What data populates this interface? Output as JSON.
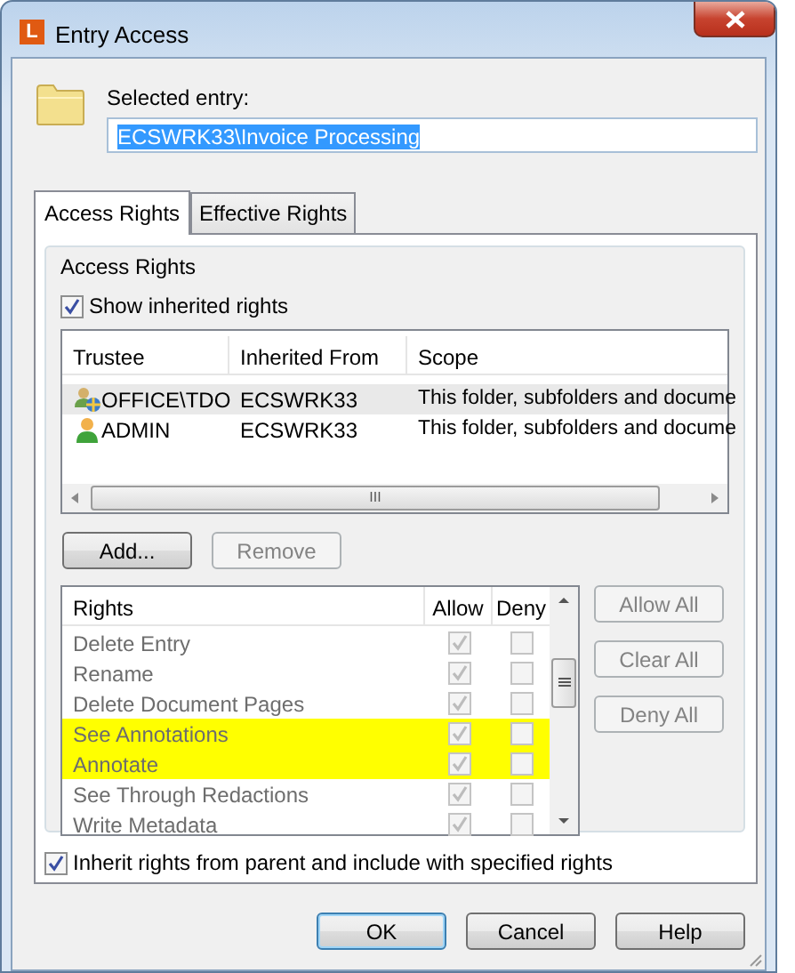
{
  "window": {
    "title": "Entry Access",
    "app_icon": "L"
  },
  "selected_entry": {
    "label": "Selected entry:",
    "value": "ECSWRK33\\Invoice Processing",
    "text_selected": true
  },
  "tabs": [
    {
      "label": "Access Rights",
      "selected": true
    },
    {
      "label": "Effective Rights",
      "selected": false
    }
  ],
  "group": {
    "title": "Access Rights",
    "show_inherited": {
      "label": "Show inherited rights",
      "checked": true
    },
    "trustees": {
      "columns": [
        "Trustee",
        "Inherited From",
        "Scope"
      ],
      "rows": [
        {
          "kind": "group",
          "trustee": "OFFICE\\TDO",
          "inherited_from": "ECSWRK33",
          "scope": "This folder, subfolders and docume",
          "selected": true
        },
        {
          "kind": "user",
          "trustee": "ADMIN",
          "inherited_from": "ECSWRK33",
          "scope": "This folder, subfolders and docume",
          "selected": false
        }
      ],
      "scroll_grip": "III"
    },
    "trustee_buttons": [
      {
        "label": "Add...",
        "disabled": false
      },
      {
        "label": "Remove",
        "disabled": true
      }
    ],
    "rights": {
      "columns": [
        "Rights",
        "Allow",
        "Deny"
      ],
      "rows": [
        {
          "name": "Delete Entry",
          "allow": true,
          "deny": false,
          "disabled": true,
          "highlighted": false
        },
        {
          "name": "Rename",
          "allow": true,
          "deny": false,
          "disabled": true,
          "highlighted": false
        },
        {
          "name": "Delete Document Pages",
          "allow": true,
          "deny": false,
          "disabled": true,
          "highlighted": false
        },
        {
          "name": "See Annotations",
          "allow": true,
          "deny": false,
          "disabled": true,
          "highlighted": true
        },
        {
          "name": "Annotate",
          "allow": true,
          "deny": false,
          "disabled": true,
          "highlighted": true
        },
        {
          "name": "See Through Redactions",
          "allow": true,
          "deny": false,
          "disabled": true,
          "highlighted": false
        },
        {
          "name": "Write Metadata",
          "allow": true,
          "deny": false,
          "disabled": true,
          "highlighted": false
        }
      ]
    },
    "rights_buttons": [
      {
        "label": "Allow All",
        "disabled": true
      },
      {
        "label": "Clear All",
        "disabled": true
      },
      {
        "label": "Deny All",
        "disabled": true
      }
    ]
  },
  "inherit": {
    "label": "Inherit rights from parent and include with specified rights",
    "checked": true
  },
  "buttons": [
    {
      "label": "OK",
      "default": true
    },
    {
      "label": "Cancel",
      "default": false
    },
    {
      "label": "Help",
      "default": false
    }
  ]
}
